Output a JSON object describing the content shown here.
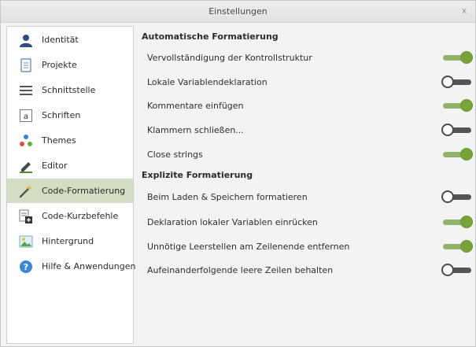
{
  "window": {
    "title": "Einstellungen",
    "close_glyph": "x"
  },
  "sidebar": {
    "items": [
      {
        "label": "Identität",
        "icon": "person-icon",
        "active": false
      },
      {
        "label": "Projekte",
        "icon": "document-icon",
        "active": false
      },
      {
        "label": "Schnittstelle",
        "icon": "menu-lines-icon",
        "active": false
      },
      {
        "label": "Schriften",
        "icon": "font-a-icon",
        "active": false
      },
      {
        "label": "Themes",
        "icon": "palette-dots-icon",
        "active": false
      },
      {
        "label": "Editor",
        "icon": "pencil-icon",
        "active": false
      },
      {
        "label": "Code-Formatierung",
        "icon": "magic-wand-icon",
        "active": true
      },
      {
        "label": "Code-Kurzbefehle",
        "icon": "code-add-icon",
        "active": false
      },
      {
        "label": "Hintergrund",
        "icon": "image-icon",
        "active": false
      },
      {
        "label": "Hilfe & Anwendungen",
        "icon": "help-icon",
        "active": false
      }
    ]
  },
  "sections": {
    "automatic": {
      "title": "Automatische Formatierung",
      "options": [
        {
          "label": "Vervollständigung der Kontrollstruktur",
          "enabled": true
        },
        {
          "label": "Lokale Variablendeklaration",
          "enabled": false
        },
        {
          "label": "Kommentare einfügen",
          "enabled": true
        },
        {
          "label": "Klammern schließen...",
          "enabled": false
        },
        {
          "label": "Close strings",
          "enabled": true
        }
      ]
    },
    "explicit": {
      "title": "Explizite Formatierung",
      "options": [
        {
          "label": "Beim Laden & Speichern formatieren",
          "enabled": false
        },
        {
          "label": "Deklaration lokaler Variablen einrücken",
          "enabled": true
        },
        {
          "label": "Unnötige Leerstellen am Zeilenende entfernen",
          "enabled": true
        },
        {
          "label": "Aufeinanderfolgende leere Zeilen behalten",
          "enabled": false
        }
      ]
    }
  },
  "colors": {
    "toggle_on_track": "#93b26a",
    "toggle_on_knob": "#77a338",
    "toggle_off_track": "#555555",
    "active_nav_bg": "#d3ddc4"
  }
}
